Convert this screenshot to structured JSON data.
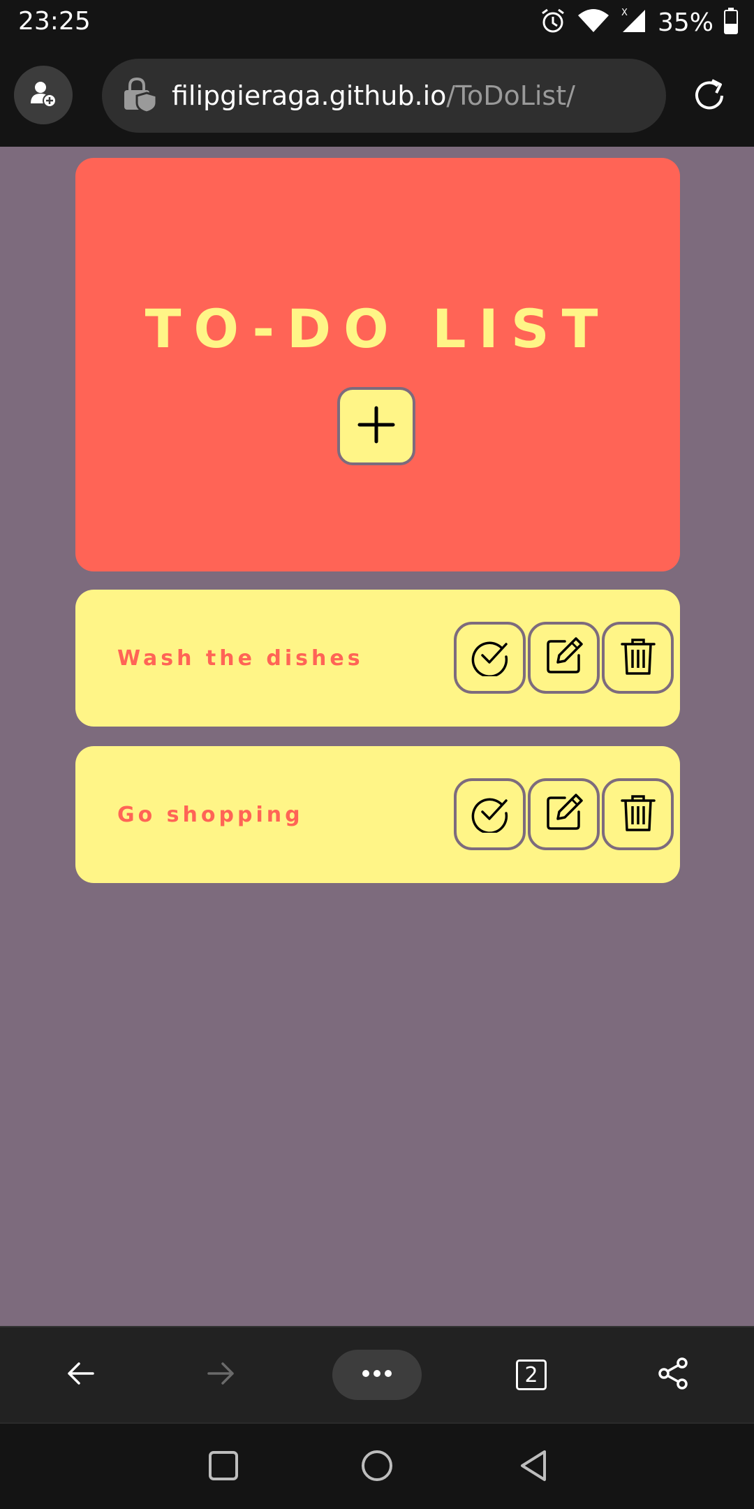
{
  "status_bar": {
    "time": "23:25",
    "battery": "35%",
    "icons": [
      "alarm-icon",
      "wifi-icon",
      "cell-signal-icon",
      "battery-icon"
    ]
  },
  "browser": {
    "url_domain": "filipgieraga.github.io",
    "url_path": "/ToDoList/",
    "tab_count": "2",
    "icons": [
      "profile-add-icon",
      "lock-shield-icon",
      "reload-icon",
      "back-arrow-icon",
      "forward-arrow-icon",
      "more-dots-icon",
      "tabs-icon",
      "share-icon"
    ]
  },
  "app": {
    "title": "TO-DO LIST",
    "tasks": [
      {
        "label": "Wash the dishes"
      },
      {
        "label": "Go shopping"
      }
    ]
  },
  "colors": {
    "page_background": "#7d6b7d",
    "header_card": "#ff6456",
    "accent_yellow": "#fff587",
    "task_text": "#ff6456"
  },
  "system_nav": {
    "icons": [
      "recents-square-icon",
      "home-circle-icon",
      "back-triangle-icon"
    ]
  }
}
